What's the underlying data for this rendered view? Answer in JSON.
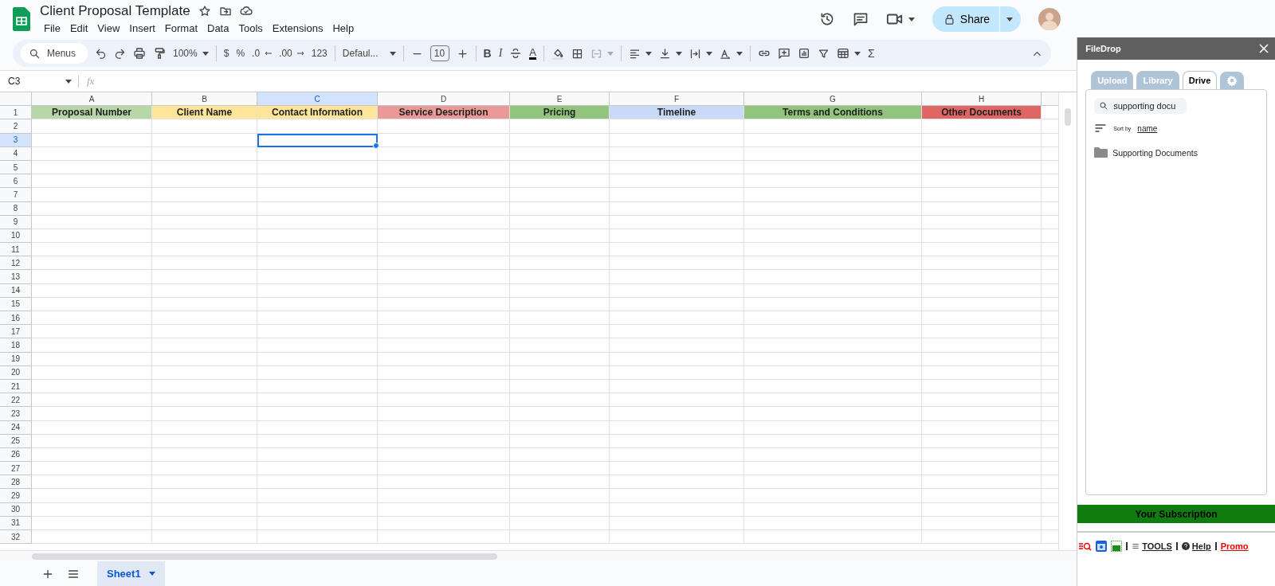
{
  "document": {
    "title": "Client Proposal Template",
    "menus": [
      "File",
      "Edit",
      "View",
      "Insert",
      "Format",
      "Data",
      "Tools",
      "Extensions",
      "Help"
    ],
    "share_label": "Share"
  },
  "toolbar": {
    "search_placeholder": "Menus",
    "zoom": "100%",
    "currency": "$",
    "percent": "%",
    "decrease_decimal": ".0",
    "increase_decimal": ".00",
    "number_format": "123",
    "font": "Defaul...",
    "font_size": "10",
    "bold": "B",
    "italic": "I",
    "text_color": "A",
    "function": "Σ"
  },
  "formula_bar": {
    "cell_reference": "C3",
    "formula_label": "fx"
  },
  "sheet": {
    "columns": [
      {
        "label": "A",
        "selected": false
      },
      {
        "label": "B",
        "selected": false
      },
      {
        "label": "C",
        "selected": true
      },
      {
        "label": "D",
        "selected": false
      },
      {
        "label": "E",
        "selected": false
      },
      {
        "label": "F",
        "selected": false
      },
      {
        "label": "G",
        "selected": false
      },
      {
        "label": "H",
        "selected": false
      }
    ],
    "headings": [
      {
        "text": "Proposal Number",
        "color": "#b7d7a8"
      },
      {
        "text": "Client Name",
        "color": "#ffe599"
      },
      {
        "text": "Contact Information",
        "color": "#ffe599"
      },
      {
        "text": "Service Description",
        "color": "#ea9999"
      },
      {
        "text": "Pricing",
        "color": "#93c47d"
      },
      {
        "text": "Timeline",
        "color": "#c9daf8"
      },
      {
        "text": "Terms and Conditions",
        "color": "#93c47d"
      },
      {
        "text": "Other Documents",
        "color": "#e06666"
      }
    ],
    "rows": [
      {
        "label": "1",
        "selected": false
      },
      {
        "label": "2",
        "selected": false
      },
      {
        "label": "3",
        "selected": true
      },
      {
        "label": "4",
        "selected": false
      },
      {
        "label": "5",
        "selected": false
      },
      {
        "label": "6",
        "selected": false
      },
      {
        "label": "7",
        "selected": false
      },
      {
        "label": "8",
        "selected": false
      },
      {
        "label": "9",
        "selected": false
      },
      {
        "label": "10",
        "selected": false
      },
      {
        "label": "11",
        "selected": false
      },
      {
        "label": "12",
        "selected": false
      },
      {
        "label": "13",
        "selected": false
      },
      {
        "label": "14",
        "selected": false
      },
      {
        "label": "15",
        "selected": false
      },
      {
        "label": "16",
        "selected": false
      },
      {
        "label": "17",
        "selected": false
      },
      {
        "label": "18",
        "selected": false
      },
      {
        "label": "19",
        "selected": false
      },
      {
        "label": "20",
        "selected": false
      },
      {
        "label": "21",
        "selected": false
      },
      {
        "label": "22",
        "selected": false
      },
      {
        "label": "23",
        "selected": false
      },
      {
        "label": "24",
        "selected": false
      },
      {
        "label": "25",
        "selected": false
      },
      {
        "label": "26",
        "selected": false
      },
      {
        "label": "27",
        "selected": false
      },
      {
        "label": "28",
        "selected": false
      },
      {
        "label": "29",
        "selected": false
      },
      {
        "label": "30",
        "selected": false
      },
      {
        "label": "31",
        "selected": false
      },
      {
        "label": "32",
        "selected": false
      }
    ]
  },
  "sheet_tabs": [
    {
      "label": "Sheet1",
      "selected": true
    }
  ],
  "sidebar": {
    "title": "FileDrop",
    "tabs": [
      {
        "label": "Upload",
        "selected": false
      },
      {
        "label": "Library",
        "selected": false
      },
      {
        "label": "Drive",
        "selected": true
      }
    ],
    "search_value": "supporting docu",
    "sort_label": "Sort by",
    "sort_field": "name",
    "files": [
      {
        "name": "Supporting Documents",
        "kind": "folder"
      }
    ],
    "subscription": "Your Subscription",
    "footer_links": [
      {
        "label": "TOOLS",
        "kind": "tools"
      },
      {
        "label": "Help",
        "kind": "help"
      },
      {
        "label": "Promo",
        "kind": "promo"
      }
    ]
  }
}
